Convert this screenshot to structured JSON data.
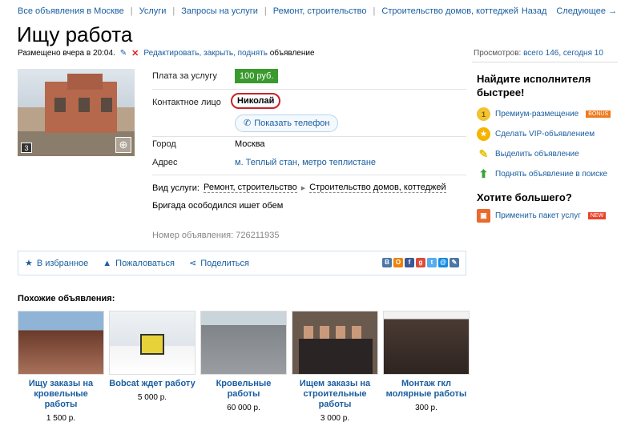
{
  "breadcrumbs": [
    "Все объявления в Москве",
    "Услуги",
    "Запросы на услуги",
    "Ремонт, строительство",
    "Строительство домов, коттеджей"
  ],
  "pager": {
    "back": "Назад",
    "next": "Следующее →"
  },
  "title": "Ищу работа",
  "meta": {
    "posted": "Размещено вчера в 20:04.",
    "edit_links": "Редактировать, закрыть, поднять",
    "edit_tail": "объявление"
  },
  "views": {
    "label": "Просмотров:",
    "value": "всего 146, сегодня 10"
  },
  "photo": {
    "count": "3"
  },
  "fields": {
    "price_label": "Плата за услугу",
    "price_value": "100 руб.",
    "contact_label": "Контактное лицо",
    "contact_value": "Николай",
    "phone_button": "Показать телефон",
    "city_label": "Город",
    "city_value": "Москва",
    "address_label": "Адрес",
    "address_value": "м. Теплый стан, метро теплистане"
  },
  "service": {
    "label": "Вид услуги:",
    "cat1": "Ремонт, строительство",
    "cat2": "Строительство домов, коттеджей"
  },
  "description": "Бригада осободился ишет обем",
  "ad_number": "Номер объявления: 726211935",
  "actions": {
    "favorite": "В избранное",
    "complain": "Пожаловаться",
    "share": "Поделиться"
  },
  "share_icons": [
    {
      "letter": "В",
      "color": "#4a76a8"
    },
    {
      "letter": "О",
      "color": "#ee8208"
    },
    {
      "letter": "f",
      "color": "#3b5998"
    },
    {
      "letter": "g",
      "color": "#dd4b39"
    },
    {
      "letter": "t",
      "color": "#55acee"
    },
    {
      "letter": "@",
      "color": "#168de2"
    },
    {
      "letter": "✎",
      "color": "#4a76a8"
    }
  ],
  "sidebar": {
    "title1": "Найдите исполнителя быстрее!",
    "items": [
      {
        "label": "Премиум-размещение",
        "tag": "BONUS",
        "icon": "coin-icon"
      },
      {
        "label": "Сделать VIP-объявлением",
        "icon": "vip-medal-icon"
      },
      {
        "label": "Выделить объявление",
        "icon": "highlighter-icon"
      },
      {
        "label": "Поднять объявление в поиске",
        "icon": "up-arrow-icon"
      }
    ],
    "title2": "Хотите большего?",
    "package": {
      "label": "Применить пакет услуг",
      "tag": "NEW",
      "icon": "gift-box-icon"
    }
  },
  "similar": {
    "title": "Похожие объявления:",
    "items": [
      {
        "title": "Ищу заказы на кровельные работы",
        "price": "1 500 р."
      },
      {
        "title": "Bobcat ждет работу",
        "price": "5 000 р."
      },
      {
        "title": "Кровельные работы",
        "price": "60 000 р."
      },
      {
        "title": "Ищем заказы на строительные работы",
        "price": "3 000 р."
      },
      {
        "title": "Монтаж гкл молярные работы",
        "price": "300 р."
      }
    ]
  },
  "colors": {
    "link": "#1a5ea0",
    "price_badge": "#3a9a2e",
    "highlight_ring": "#c8232a"
  }
}
